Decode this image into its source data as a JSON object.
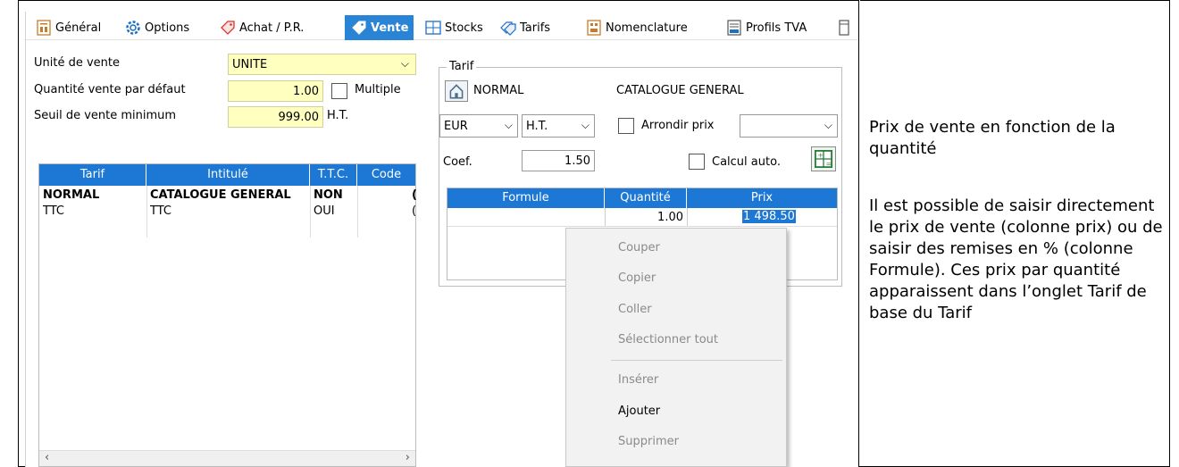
{
  "tabs": [
    {
      "label": "Général",
      "icon": "general-icon"
    },
    {
      "label": "Options",
      "icon": "gear-icon"
    },
    {
      "label": "Achat / P.R.",
      "icon": "purchase-tag-icon"
    },
    {
      "label": "Vente",
      "icon": "sale-tag-icon",
      "active": true
    },
    {
      "label": "Stocks",
      "icon": "stocks-icon"
    },
    {
      "label": "Tarifs",
      "icon": "tarifs-icon"
    },
    {
      "label": "Nomenclature",
      "icon": "nomenclature-icon"
    },
    {
      "label": "Profils TVA",
      "icon": "tva-icon"
    }
  ],
  "form": {
    "unite_label": "Unité de vente",
    "unite_value": "UNITE",
    "qte_label": "Quantité vente par défaut",
    "qte_value": "1.00",
    "multiple_label": "Multiple",
    "seuil_label": "Seuil de vente minimum",
    "seuil_value": "999.00",
    "seuil_suffix": "H.T."
  },
  "grid1": {
    "headers": [
      "Tarif",
      "Intitulé",
      "T.T.C.",
      "Code"
    ],
    "rows": [
      {
        "tarif": "NORMAL",
        "intitule": "CATALOGUE GENERAL",
        "ttc": "NON",
        "code": "(",
        "bold": true
      },
      {
        "tarif": "TTC",
        "intitule": "TTC",
        "ttc": "OUI",
        "code": "(",
        "bold": false
      }
    ]
  },
  "tarif_group": {
    "title": "Tarif",
    "tarif_name": "NORMAL",
    "catalogue": "CATALOGUE GENERAL",
    "currency": "EUR",
    "tax_mode": "H.T.",
    "arrondir_label": "Arrondir prix",
    "arrondir_value": "",
    "coef_label": "Coef.",
    "coef_value": "1.50",
    "calcul_auto_label": "Calcul auto."
  },
  "grid2": {
    "headers": [
      "Formule",
      "Quantité",
      "Prix"
    ],
    "rows": [
      {
        "formule": "",
        "quantite": "1.00",
        "prix": "1 498.50"
      }
    ]
  },
  "context_menu": {
    "items": [
      {
        "label": "Couper",
        "enabled": false
      },
      {
        "label": "Copier",
        "enabled": false
      },
      {
        "label": "Coller",
        "enabled": false
      },
      {
        "label": "Sélectionner tout",
        "enabled": false
      },
      {
        "label": "Insérer",
        "enabled": false
      },
      {
        "label": "Ajouter",
        "enabled": true
      },
      {
        "label": "Supprimer",
        "enabled": false
      }
    ]
  },
  "note": {
    "title": "Prix de vente en fonction de la quantité",
    "body": "Il est possible de saisir directement le prix de vente (colonne prix) ou de saisir des remises en % (colonne Formule). Ces prix par quantité apparaissent dans l’onglet Tarif de base du Tarif"
  },
  "colors": {
    "accent": "#1c78d4",
    "highlight": "#ffffc0",
    "selected_row": "#cce4f7"
  }
}
